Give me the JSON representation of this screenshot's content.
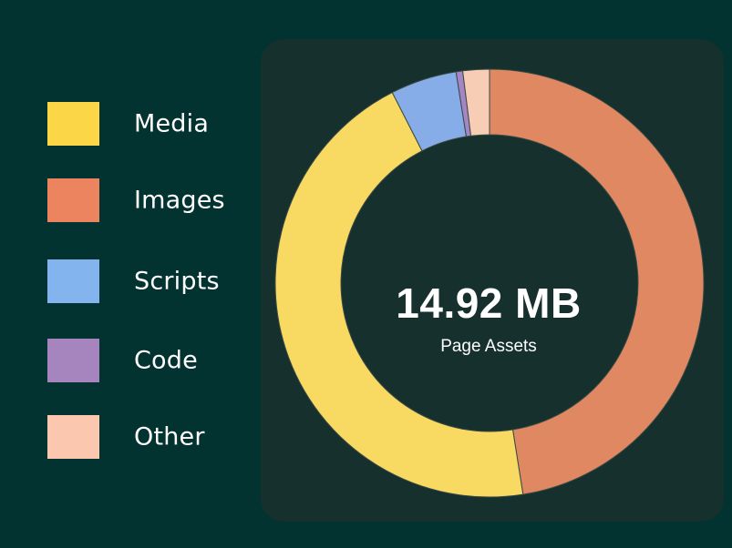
{
  "chart_data": {
    "type": "pie",
    "variant": "donut",
    "center_value": "14.92 MB",
    "center_label": "Page Assets",
    "legend_position": "left",
    "slices": [
      {
        "label": "Images",
        "value": 47.5,
        "color": "#DF8862"
      },
      {
        "label": "Media",
        "value": 45.0,
        "color": "#F8DA62"
      },
      {
        "label": "Scripts",
        "value": 5.0,
        "color": "#86ADE8"
      },
      {
        "label": "Code",
        "value": 0.5,
        "color": "#A486C4"
      },
      {
        "label": "Other",
        "value": 2.0,
        "color": "#F7CDB6"
      }
    ],
    "legend": [
      {
        "label": "Media",
        "color": "#FBD647"
      },
      {
        "label": "Images",
        "color": "#EC855F"
      },
      {
        "label": "Scripts",
        "color": "#83B4EE"
      },
      {
        "label": "Code",
        "color": "#A684BE"
      },
      {
        "label": "Other",
        "color": "#FCC7AF"
      }
    ]
  }
}
